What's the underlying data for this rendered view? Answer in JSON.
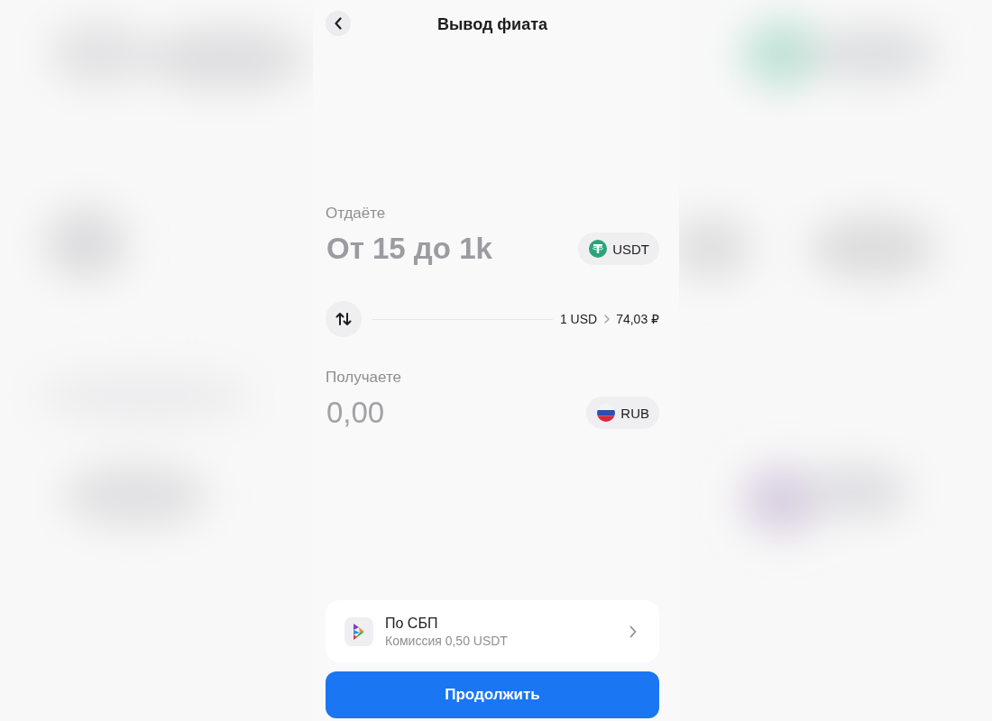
{
  "header": {
    "title": "Вывод фиата"
  },
  "send": {
    "label": "Отдаёте",
    "placeholder": "От 15 до 1k",
    "currency": "USDT"
  },
  "rate": {
    "from": "1 USD",
    "to": "74,03 ₽"
  },
  "receive": {
    "label": "Получаете",
    "amount": "0,00",
    "currency": "RUB"
  },
  "payment_method": {
    "title": "По СБП",
    "fee": "Комиссия 0,50 USDT"
  },
  "continue_button": {
    "label": "Продолжить"
  }
}
